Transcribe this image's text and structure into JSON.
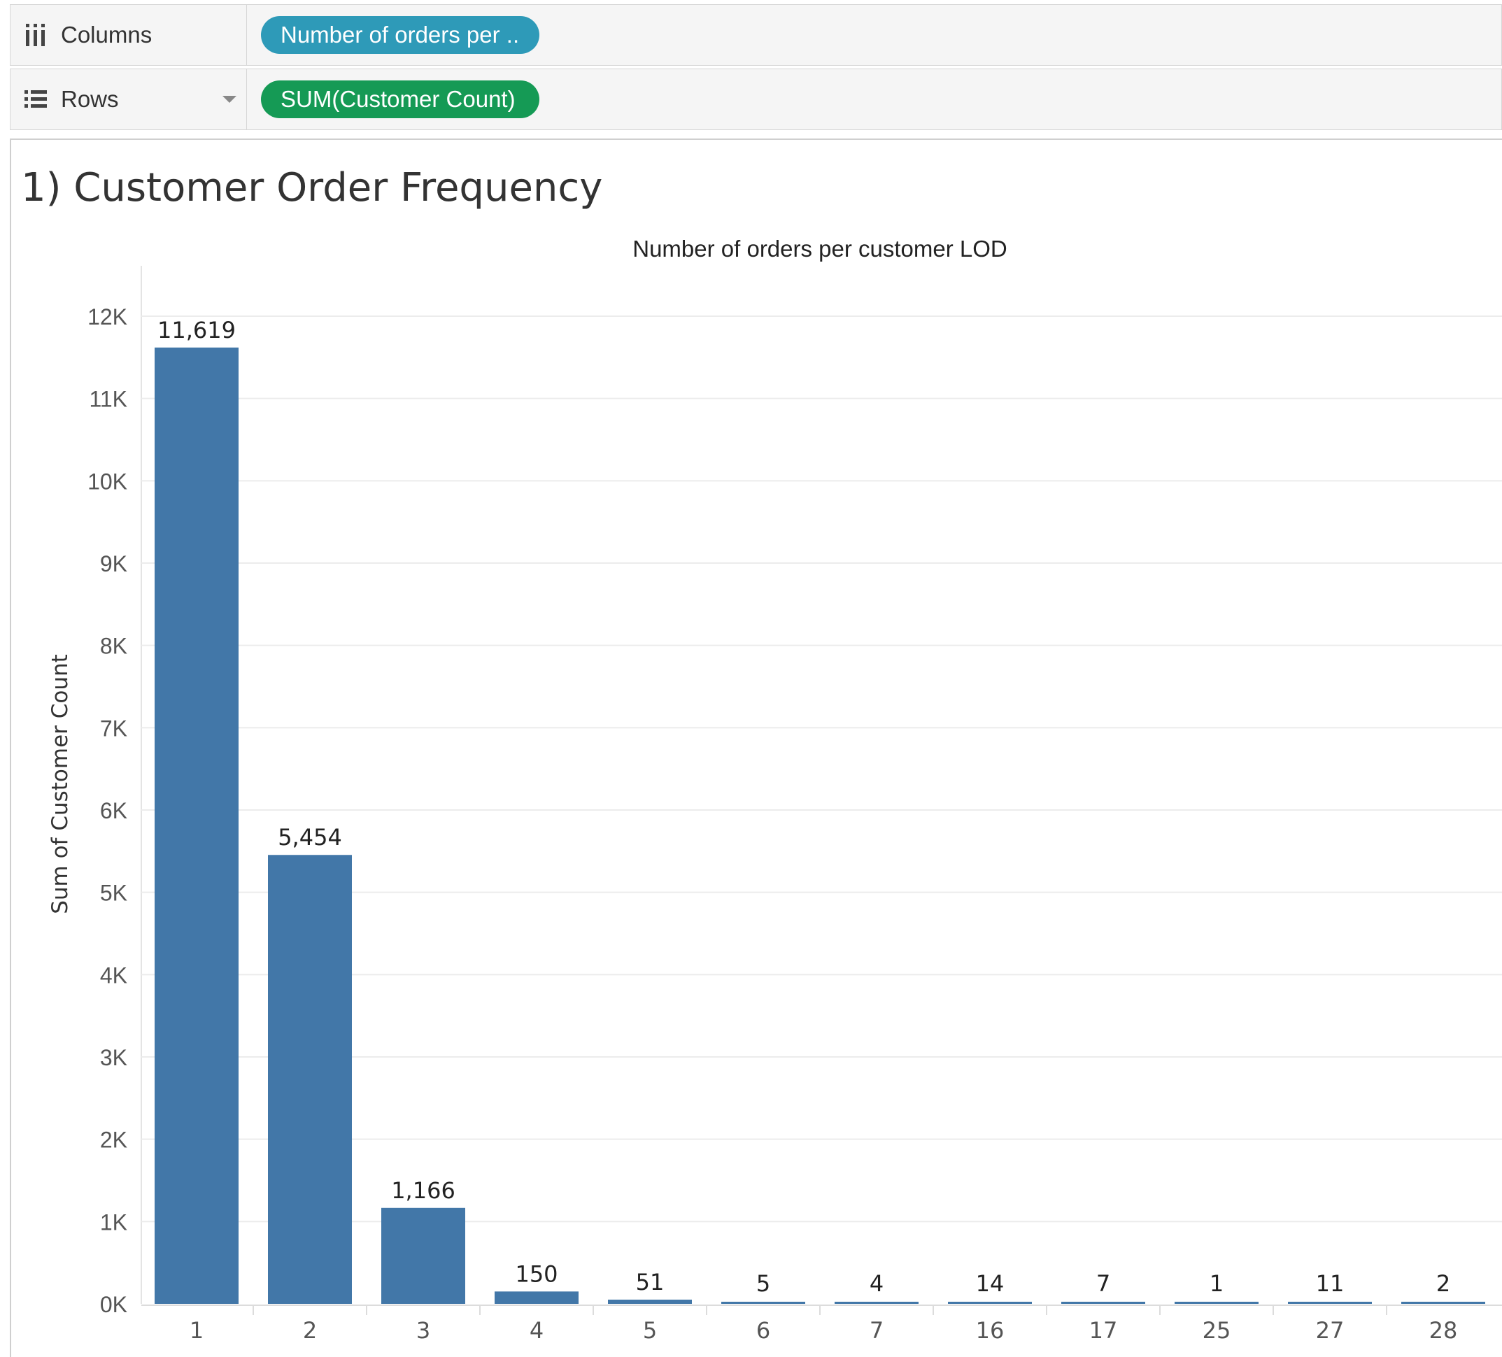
{
  "shelves": {
    "columns": {
      "label": "Columns",
      "pill": "Number of orders per .."
    },
    "rows": {
      "label": "Rows",
      "pill": "SUM(Customer Count)"
    }
  },
  "sheet": {
    "title": "1) Customer Order Frequency"
  },
  "colors": {
    "bar": "#4277a8",
    "columns_pill": "#2e9ab8",
    "rows_pill": "#159a55"
  },
  "chart_data": {
    "type": "bar",
    "title": "Number of orders per customer LOD",
    "xlabel": "",
    "ylabel": "Sum of Customer Count",
    "categories": [
      "1",
      "2",
      "3",
      "4",
      "5",
      "6",
      "7",
      "16",
      "17",
      "25",
      "27",
      "28"
    ],
    "values": [
      11619,
      5454,
      1166,
      150,
      51,
      5,
      4,
      14,
      7,
      1,
      11,
      2
    ],
    "value_labels": [
      "11,619",
      "5,454",
      "1,166",
      "150",
      "51",
      "5",
      "4",
      "14",
      "7",
      "1",
      "11",
      "2"
    ],
    "ylim": [
      0,
      12000
    ],
    "yticks": [
      0,
      1000,
      2000,
      3000,
      4000,
      5000,
      6000,
      7000,
      8000,
      9000,
      10000,
      11000,
      12000
    ],
    "ytick_labels": [
      "0K",
      "1K",
      "2K",
      "3K",
      "4K",
      "5K",
      "6K",
      "7K",
      "8K",
      "9K",
      "10K",
      "11K",
      "12K"
    ],
    "grid": true,
    "legend": "none"
  }
}
